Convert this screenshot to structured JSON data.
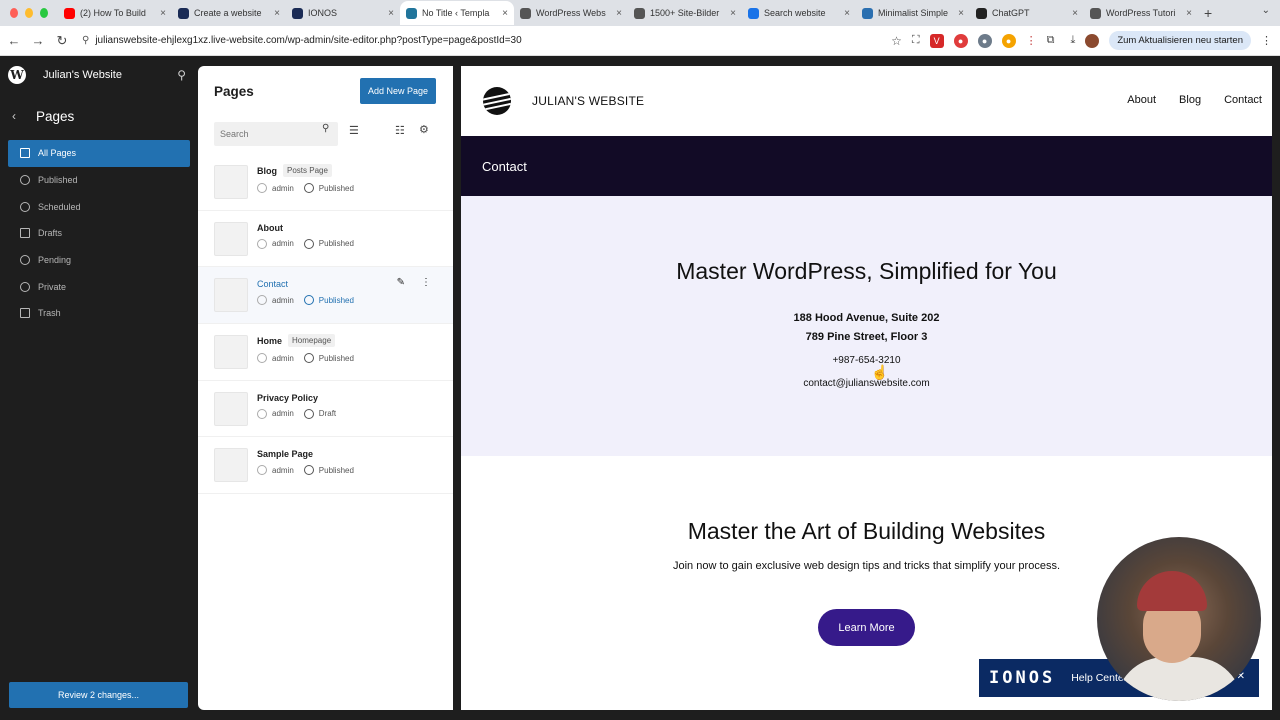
{
  "browser": {
    "tabs": [
      {
        "label": "(2) How To Build",
        "icon_color": "#ff0000",
        "icon": "youtube-icon"
      },
      {
        "label": "Create a website",
        "icon_color": "#1a2b55",
        "icon": "ionos-icon"
      },
      {
        "label": "IONOS",
        "icon_color": "#1a2b55",
        "icon": "ionos-icon"
      },
      {
        "label": "No Title ‹ Templa",
        "icon_color": "#21759b",
        "icon": "wordpress-icon",
        "active": true
      },
      {
        "label": "WordPress Webs",
        "icon_color": "#555555",
        "icon": "site-icon"
      },
      {
        "label": "1500+ Site-Bilder",
        "icon_color": "#555555",
        "icon": "site-icon"
      },
      {
        "label": "Search website",
        "icon_color": "#1a73e8",
        "icon": "google-icon"
      },
      {
        "label": "Minimalist Simple",
        "icon_color": "#2a6fb0",
        "icon": "site-icon"
      },
      {
        "label": "ChatGPT",
        "icon_color": "#222222",
        "icon": "chatgpt-icon"
      },
      {
        "label": "WordPress Tutori",
        "icon_color": "#555555",
        "icon": "site-icon"
      }
    ],
    "url": "julianswebsite-ehjlexg1xz.live-website.com/wp-admin/site-editor.php?postType=page&postId=30",
    "update_button": "Zum Aktualisieren neu starten"
  },
  "sidebar": {
    "site_name": "Julian's Website",
    "section_title": "Pages",
    "items": [
      {
        "label": "All Pages",
        "icon": "pages-icon",
        "active": true
      },
      {
        "label": "Published",
        "icon": "published-icon"
      },
      {
        "label": "Scheduled",
        "icon": "scheduled-icon"
      },
      {
        "label": "Drafts",
        "icon": "drafts-icon"
      },
      {
        "label": "Pending",
        "icon": "pending-icon"
      },
      {
        "label": "Private",
        "icon": "private-icon"
      },
      {
        "label": "Trash",
        "icon": "trash-icon"
      }
    ],
    "review_button": "Review 2 changes..."
  },
  "pages_panel": {
    "title": "Pages",
    "add_button": "Add New Page",
    "search_placeholder": "Search",
    "rows": [
      {
        "name": "Blog",
        "badge": "Posts Page",
        "author": "admin",
        "status": "Published"
      },
      {
        "name": "About",
        "badge": "",
        "author": "admin",
        "status": "Published"
      },
      {
        "name": "Contact",
        "badge": "",
        "author": "admin",
        "status": "Published",
        "selected": true
      },
      {
        "name": "Home",
        "badge": "Homepage",
        "author": "admin",
        "status": "Published"
      },
      {
        "name": "Privacy Policy",
        "badge": "",
        "author": "admin",
        "status": "Draft"
      },
      {
        "name": "Sample Page",
        "badge": "",
        "author": "admin",
        "status": "Published"
      }
    ]
  },
  "preview": {
    "site_title": "JULIAN'S WEBSITE",
    "nav": [
      "About",
      "Blog",
      "Contact"
    ],
    "banner_title": "Contact",
    "contact": {
      "heading": "Master WordPress, Simplified for You",
      "address_1": "188 Hood Avenue, Suite 202",
      "address_2": "789 Pine Street, Floor 3",
      "phone": "+987-654-3210",
      "email": "contact@julianswebsite.com"
    },
    "cta": {
      "heading": "Master the Art of Building Websites",
      "subtext": "Join now to gain exclusive web design tips and tricks that simplify your process.",
      "button": "Learn More"
    }
  },
  "overlay": {
    "ionos_logo": "IONOS",
    "help_label": "Help Center"
  },
  "colors": {
    "wp_blue": "#2271b1",
    "banner_dark": "#120b26",
    "section_lilac": "#f1f0fb",
    "cta_purple": "#361a8a",
    "ionos_navy": "#0b2a63"
  }
}
